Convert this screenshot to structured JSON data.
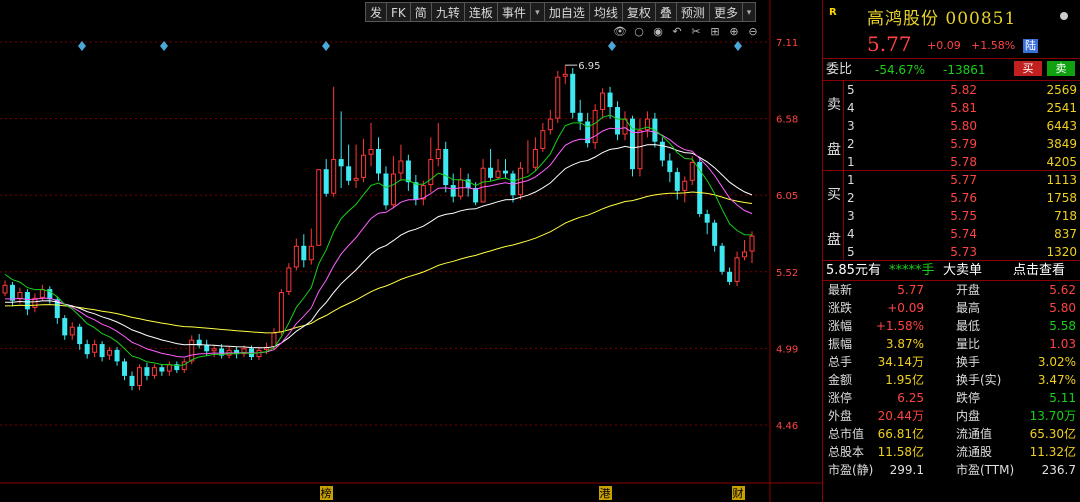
{
  "toolbar": {
    "items": [
      "发",
      "FK",
      "简",
      "九转",
      "连板",
      "事件",
      "▾",
      "加自选",
      "均线",
      "复权",
      "叠",
      "预测",
      "更多",
      "▾"
    ]
  },
  "chart_icons": [
    "eye-icon",
    "circle-icon",
    "record-icon",
    "undo-icon",
    "scissors-icon",
    "grid-icon",
    "zoom-in-icon",
    "zoom-out-icon"
  ],
  "chart_data": {
    "type": "candlestick",
    "y_ticks": [
      "7.11",
      "6.58",
      "6.05",
      "5.52",
      "4.99",
      "4.46"
    ],
    "ylim": [
      4.46,
      7.11
    ],
    "high_label": "6.95",
    "events": [
      "榜",
      "港",
      "财"
    ],
    "colors": {
      "up": "#ff3838",
      "down": "#3ee8f0",
      "ma5": "#ffffff",
      "ma10": "#ffff40",
      "ma20": "#ff60ff",
      "ma60": "#18d018",
      "grid": "#7a0000"
    },
    "candles": [
      [
        5.37,
        5.43,
        5.46,
        5.35
      ],
      [
        5.43,
        5.32,
        5.45,
        5.28
      ],
      [
        5.33,
        5.38,
        5.41,
        5.3
      ],
      [
        5.38,
        5.26,
        5.4,
        5.22
      ],
      [
        5.27,
        5.34,
        5.37,
        5.24
      ],
      [
        5.34,
        5.4,
        5.43,
        5.32
      ],
      [
        5.4,
        5.33,
        5.42,
        5.3
      ],
      [
        5.33,
        5.2,
        5.35,
        5.16
      ],
      [
        5.2,
        5.08,
        5.22,
        5.05
      ],
      [
        5.08,
        5.14,
        5.17,
        5.05
      ],
      [
        5.14,
        5.02,
        5.16,
        4.98
      ],
      [
        5.02,
        4.95,
        5.05,
        4.92
      ],
      [
        4.96,
        5.02,
        5.05,
        4.93
      ],
      [
        5.02,
        4.93,
        5.04,
        4.9
      ],
      [
        4.94,
        4.98,
        5.0,
        4.91
      ],
      [
        4.98,
        4.9,
        5.0,
        4.87
      ],
      [
        4.9,
        4.8,
        4.92,
        4.77
      ],
      [
        4.8,
        4.73,
        4.83,
        4.7
      ],
      [
        4.73,
        4.86,
        4.88,
        4.7
      ],
      [
        4.86,
        4.8,
        4.89,
        4.77
      ],
      [
        4.8,
        4.86,
        4.88,
        4.78
      ],
      [
        4.86,
        4.83,
        4.88,
        4.8
      ],
      [
        4.83,
        4.88,
        4.9,
        4.8
      ],
      [
        4.88,
        4.84,
        4.9,
        4.82
      ],
      [
        4.84,
        4.9,
        4.92,
        4.82
      ],
      [
        4.9,
        5.05,
        5.08,
        4.88
      ],
      [
        5.05,
        5.01,
        5.09,
        4.99
      ],
      [
        5.01,
        4.97,
        5.05,
        4.94
      ],
      [
        4.97,
        4.99,
        5.01,
        4.93
      ],
      [
        4.99,
        4.94,
        5.02,
        4.92
      ],
      [
        4.94,
        4.98,
        5.0,
        4.92
      ],
      [
        4.98,
        4.95,
        5.0,
        4.92
      ],
      [
        4.95,
        4.99,
        5.01,
        4.93
      ],
      [
        4.99,
        4.93,
        5.01,
        4.91
      ],
      [
        4.93,
        4.98,
        5.0,
        4.91
      ],
      [
        4.98,
        5.0,
        5.03,
        4.95
      ],
      [
        5.0,
        5.1,
        5.13,
        4.98
      ],
      [
        5.1,
        5.38,
        5.4,
        5.08
      ],
      [
        5.38,
        5.55,
        5.58,
        5.36
      ],
      [
        5.55,
        5.7,
        5.75,
        5.53
      ],
      [
        5.7,
        5.6,
        5.78,
        5.55
      ],
      [
        5.6,
        5.7,
        5.82,
        5.57
      ],
      [
        5.7,
        6.23,
        6.23,
        6.02
      ],
      [
        6.23,
        6.06,
        6.3,
        6.04
      ],
      [
        6.06,
        6.3,
        6.8,
        6.04
      ],
      [
        6.3,
        6.25,
        6.63,
        6.1
      ],
      [
        6.25,
        6.15,
        6.4,
        6.12
      ],
      [
        6.15,
        6.17,
        6.4,
        6.1
      ],
      [
        6.17,
        6.33,
        6.44,
        6.14
      ],
      [
        6.33,
        6.37,
        6.55,
        6.25
      ],
      [
        6.37,
        6.2,
        6.45,
        6.15
      ],
      [
        6.2,
        5.98,
        6.25,
        5.95
      ],
      [
        5.98,
        6.2,
        6.32,
        5.96
      ],
      [
        6.2,
        6.29,
        6.4,
        6.15
      ],
      [
        6.29,
        6.14,
        6.33,
        6.08
      ],
      [
        6.14,
        6.02,
        6.19,
        5.98
      ],
      [
        6.02,
        6.12,
        6.15,
        5.98
      ],
      [
        6.12,
        6.3,
        6.45,
        6.07
      ],
      [
        6.3,
        6.37,
        6.55,
        6.25
      ],
      [
        6.37,
        6.12,
        6.42,
        6.07
      ],
      [
        6.12,
        6.04,
        6.2,
        6.0
      ],
      [
        6.04,
        6.16,
        6.24,
        6.02
      ],
      [
        6.16,
        6.1,
        6.2,
        6.04
      ],
      [
        6.1,
        6.0,
        6.14,
        5.98
      ],
      [
        6.0,
        6.24,
        6.3,
        6.0
      ],
      [
        6.24,
        6.17,
        6.37,
        6.15
      ],
      [
        6.17,
        6.22,
        6.3,
        6.16
      ],
      [
        6.22,
        6.2,
        6.3,
        6.17
      ],
      [
        6.2,
        6.05,
        6.22,
        6.0
      ],
      [
        6.05,
        6.24,
        6.28,
        6.02
      ],
      [
        6.24,
        6.24,
        6.43,
        6.2
      ],
      [
        6.24,
        6.37,
        6.45,
        6.22
      ],
      [
        6.37,
        6.5,
        6.55,
        6.35
      ],
      [
        6.5,
        6.58,
        6.64,
        6.47
      ],
      [
        6.58,
        6.87,
        6.91,
        6.55
      ],
      [
        6.87,
        6.89,
        6.95,
        6.82
      ],
      [
        6.89,
        6.62,
        6.93,
        6.58
      ],
      [
        6.62,
        6.56,
        6.71,
        6.5
      ],
      [
        6.56,
        6.41,
        6.62,
        6.38
      ],
      [
        6.41,
        6.64,
        6.68,
        6.37
      ],
      [
        6.64,
        6.76,
        6.79,
        6.58
      ],
      [
        6.76,
        6.66,
        6.8,
        6.58
      ],
      [
        6.66,
        6.47,
        6.7,
        6.43
      ],
      [
        6.47,
        6.58,
        6.63,
        6.43
      ],
      [
        6.58,
        6.23,
        6.6,
        6.18
      ],
      [
        6.23,
        6.5,
        6.58,
        6.18
      ],
      [
        6.5,
        6.58,
        6.63,
        6.45
      ],
      [
        6.58,
        6.42,
        6.62,
        6.38
      ],
      [
        6.42,
        6.29,
        6.45,
        6.25
      ],
      [
        6.29,
        6.21,
        6.34,
        6.14
      ],
      [
        6.21,
        6.08,
        6.24,
        6.02
      ],
      [
        6.08,
        6.15,
        6.18,
        6.0
      ],
      [
        6.15,
        6.28,
        6.32,
        6.12
      ],
      [
        6.28,
        5.92,
        6.3,
        5.9
      ],
      [
        5.92,
        5.86,
        5.95,
        5.78
      ],
      [
        5.86,
        5.7,
        5.88,
        5.66
      ],
      [
        5.7,
        5.52,
        5.72,
        5.5
      ],
      [
        5.52,
        5.45,
        5.55,
        5.43
      ],
      [
        5.45,
        5.62,
        5.66,
        5.42
      ],
      [
        5.62,
        5.66,
        5.74,
        5.6
      ],
      [
        5.66,
        5.77,
        5.8,
        5.58
      ]
    ]
  },
  "panel": {
    "badge": "R",
    "name": "高鸿股份",
    "code": "000851",
    "price": "5.77",
    "change": "+0.09",
    "change_pct": "+1.58%",
    "market_tag": "陆",
    "weibi_label": "委比",
    "weibi_pct": "-54.67%",
    "weibi_diff": "-13861",
    "sell_btn": "买",
    "buy_btn": "卖",
    "sell_side_label": [
      "卖",
      "盘"
    ],
    "buy_side_label": [
      "买",
      "盘"
    ],
    "asks": [
      {
        "n": "5",
        "p": "5.82",
        "v": "2569"
      },
      {
        "n": "4",
        "p": "5.81",
        "v": "2541"
      },
      {
        "n": "3",
        "p": "5.80",
        "v": "6443"
      },
      {
        "n": "2",
        "p": "5.79",
        "v": "3849"
      },
      {
        "n": "1",
        "p": "5.78",
        "v": "4205"
      }
    ],
    "bids": [
      {
        "n": "1",
        "p": "5.77",
        "v": "1113"
      },
      {
        "n": "2",
        "p": "5.76",
        "v": "1758"
      },
      {
        "n": "3",
        "p": "5.75",
        "v": "718"
      },
      {
        "n": "4",
        "p": "5.74",
        "v": "837"
      },
      {
        "n": "5",
        "p": "5.73",
        "v": "1320"
      }
    ],
    "big_order": {
      "price": "5.85元有",
      "qty": "*****手",
      "kind": "大卖单",
      "link": "点击查看"
    },
    "quotes": [
      {
        "l": "最新",
        "v": "5.77",
        "vc": "red",
        "r": "开盘",
        "v2": "5.62",
        "v2c": "red"
      },
      {
        "l": "涨跌",
        "v": "+0.09",
        "vc": "red",
        "r": "最高",
        "v2": "5.80",
        "v2c": "red"
      },
      {
        "l": "涨幅",
        "v": "+1.58%",
        "vc": "red",
        "r": "最低",
        "v2": "5.58",
        "v2c": "green"
      },
      {
        "l": "振幅",
        "v": "3.87%",
        "vc": "yel",
        "r": "量比",
        "v2": "1.03",
        "v2c": "red"
      },
      {
        "l": "总手",
        "v": "34.14万",
        "vc": "yel",
        "r": "换手",
        "v2": "3.02%",
        "v2c": "yel"
      },
      {
        "l": "金额",
        "v": "1.95亿",
        "vc": "yel",
        "r": "换手(实)",
        "v2": "3.47%",
        "v2c": "yel"
      },
      {
        "l": "涨停",
        "v": "6.25",
        "vc": "red",
        "r": "跌停",
        "v2": "5.11",
        "v2c": "green"
      },
      {
        "l": "外盘",
        "v": "20.44万",
        "vc": "red",
        "r": "内盘",
        "v2": "13.70万",
        "v2c": "green"
      },
      {
        "l": "总市值",
        "v": "66.81亿",
        "vc": "yel",
        "r": "流通值",
        "v2": "65.30亿",
        "v2c": "yel"
      },
      {
        "l": "总股本",
        "v": "11.58亿",
        "vc": "yel",
        "r": "流通股",
        "v2": "11.32亿",
        "v2c": "yel"
      },
      {
        "l": "市盈(静)",
        "v": "299.1",
        "vc": "wht",
        "r": "市盈(TTM)",
        "v2": "236.7",
        "v2c": "wht"
      }
    ]
  }
}
